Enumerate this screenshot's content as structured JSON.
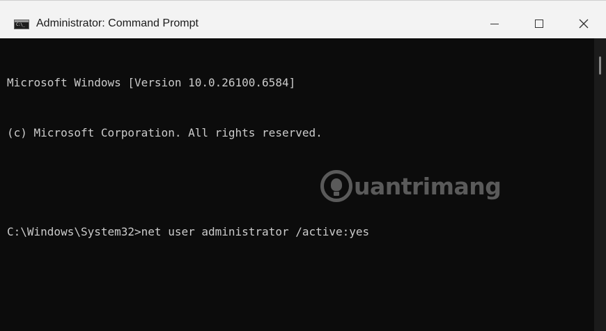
{
  "window": {
    "title": "Administrator: Command Prompt",
    "icon": "console-app-icon",
    "icon_text": "C:\\_"
  },
  "controls": {
    "minimize": "—",
    "maximize": "□",
    "close": "✕"
  },
  "console": {
    "lines": [
      "Microsoft Windows [Version 10.0.26100.6584]",
      "(c) Microsoft Corporation. All rights reserved.",
      "",
      "C:\\Windows\\System32>net user administrator /active:yes"
    ]
  },
  "watermark": {
    "text": "uantrimang"
  },
  "colors": {
    "console_bg": "#0c0c0c",
    "console_text": "#cccccc",
    "titlebar_bg": "#f3f3f3"
  }
}
